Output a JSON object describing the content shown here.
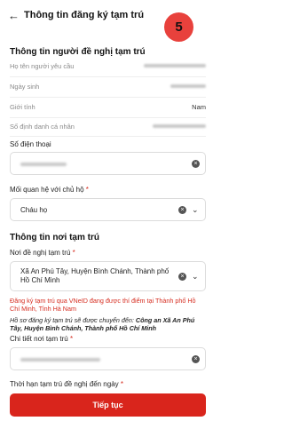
{
  "header": {
    "back_icon": "arrow-left-icon",
    "title": "Thông tin đăng ký tạm trú",
    "step": "5",
    "step_color": "#e8413c"
  },
  "requester": {
    "section_title": "Thông tin người đề nghị tạm trú",
    "fields": [
      {
        "label": "Họ tên người yêu cầu",
        "value": ""
      },
      {
        "label": "Ngày sinh",
        "value": ""
      },
      {
        "label": "Giới tính",
        "value": "Nam"
      },
      {
        "label": "Số định danh cá nhân",
        "value": ""
      }
    ],
    "phone_label": "Số điện thoại",
    "relationship_label": "Mối quan hệ với chủ hộ",
    "relationship_value": "Cháu họ"
  },
  "residence": {
    "section_title": "Thông tin nơi tạm trú",
    "place_label": "Nơi đề nghị tạm trú",
    "place_value": "Xã An Phú Tây, Huyện Bình Chánh, Thành phố Hồ Chí Minh",
    "red_notice": "Đăng ký tạm trú qua VNeID đang được thí điểm tại Thành phố Hồ Chí Minh, Tỉnh Hà Nam",
    "transfer_notice_prefix": "Hồ sơ đăng ký tạm trú sẽ được chuyển đến: ",
    "transfer_notice_target": "Công an Xã An Phú Tây, Huyện Bình Chánh, Thành phố Hồ Chí Minh",
    "detail_label": "Chi tiết nơi tạm trú",
    "duration_label": "Thời hạn tạm trú đề nghị đến ngày"
  },
  "required_mark": "*",
  "continue_label": "Tiếp tục",
  "accent_color": "#d9251c"
}
